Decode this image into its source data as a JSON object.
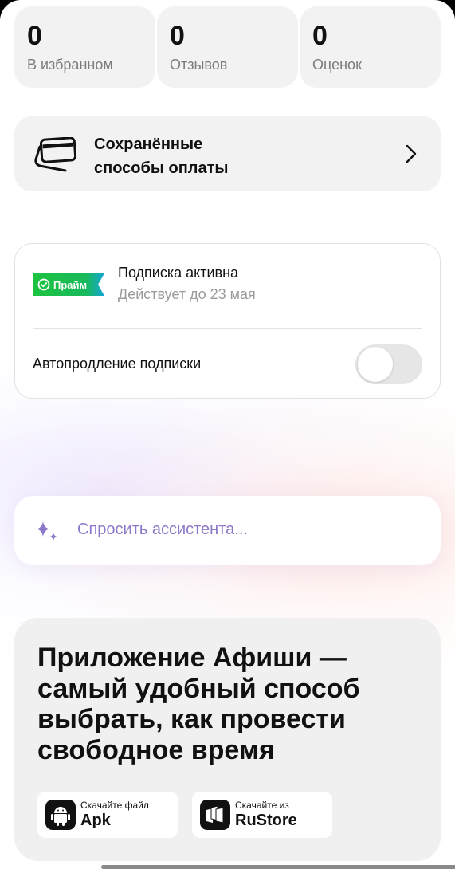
{
  "stats": [
    {
      "value": "0",
      "label": "В избранном"
    },
    {
      "value": "0",
      "label": "Отзывов"
    },
    {
      "value": "0",
      "label": "Оценок"
    }
  ],
  "payment": {
    "title_line1": "Сохранённые",
    "title_line2": "способы оплаты",
    "icon": "card-icon"
  },
  "subscription": {
    "badge": "Прайм",
    "status": "Подписка активна",
    "valid_until": "Действует до 23 мая",
    "autorenew_label": "Автопродление подписки",
    "autorenew_on": false,
    "badge_colors": {
      "start": "#1cc33f",
      "end": "#13a7d8"
    }
  },
  "assistant": {
    "placeholder": "Спросить ассистента...",
    "accent": "#8d78c9",
    "icon": "sparkle-icon"
  },
  "promo": {
    "heading_line1": "Приложение Афиши —",
    "heading_line2": "самый удобный способ",
    "heading_line3": "выбрать, как провести",
    "heading_line4": "свободное время",
    "stores": [
      {
        "small": "Скачайте файл",
        "big": "Apk",
        "icon": "android-icon"
      },
      {
        "small": "Скачайте из",
        "big": "RuStore",
        "icon": "rustore-icon"
      }
    ]
  }
}
